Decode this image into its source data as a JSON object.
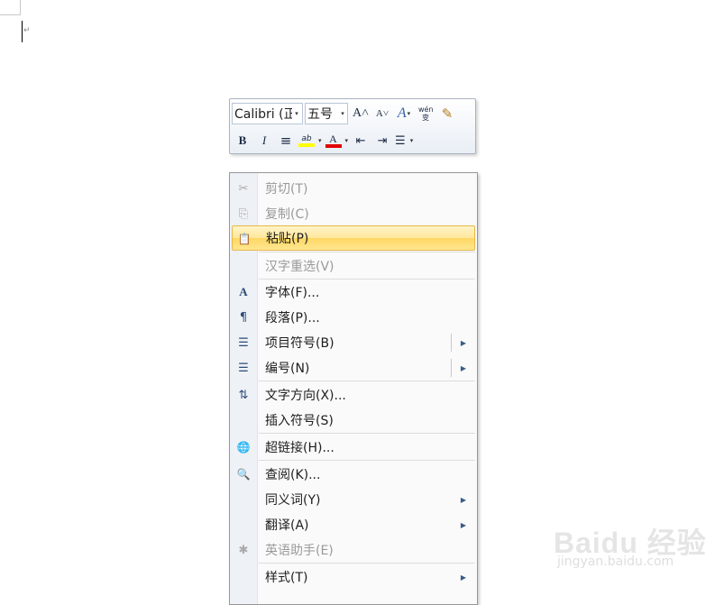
{
  "mini_toolbar": {
    "font_name": "Calibri (正",
    "font_size": "五号",
    "grow_font_icon": "A˄",
    "shrink_font_icon": "A˅",
    "styles_icon": "A",
    "phonetic_icon": "wén 变",
    "format_painter_icon": "✎",
    "bold": "B",
    "italic": "I",
    "center_icon": "≡",
    "highlight_icon": "ab",
    "font_color_icon": "A",
    "decrease_indent_icon": "⇤",
    "increase_indent_icon": "⇥",
    "bullets_icon": "☰",
    "dropdown_arrow": "▾",
    "highlight_color": "#ffff00",
    "font_color": "#e00000"
  },
  "context_menu": {
    "items": [
      {
        "label": "剪切(T)",
        "icon": "✂",
        "disabled": true
      },
      {
        "label": "复制(C)",
        "icon": "⎘",
        "disabled": true
      },
      {
        "label": "粘贴(P)",
        "icon": "📋",
        "disabled": false
      },
      {
        "label": "汉字重选(V)",
        "icon": "",
        "disabled": true
      },
      {
        "label": "字体(F)...",
        "icon": "A",
        "disabled": false
      },
      {
        "label": "段落(P)...",
        "icon": "¶",
        "disabled": false
      },
      {
        "label": "项目符号(B)",
        "icon": "☰",
        "disabled": false
      },
      {
        "label": "编号(N)",
        "icon": "☰",
        "disabled": false
      },
      {
        "label": "文字方向(X)...",
        "icon": "⇅",
        "disabled": false
      },
      {
        "label": "插入符号(S)",
        "icon": "",
        "disabled": false
      },
      {
        "label": "超链接(H)...",
        "icon": "🌐",
        "disabled": false
      },
      {
        "label": "查阅(K)...",
        "icon": "🔍",
        "disabled": false
      },
      {
        "label": "同义词(Y)",
        "icon": "",
        "disabled": false
      },
      {
        "label": "翻译(A)",
        "icon": "",
        "disabled": false
      },
      {
        "label": "英语助手(E)",
        "icon": "✱",
        "disabled": true
      },
      {
        "label": "样式(T)",
        "icon": "",
        "disabled": false
      }
    ],
    "submenu_arrow": "▶",
    "highlight_color": "#ffd763"
  },
  "document": {
    "paragraph_mark": "↵"
  },
  "watermark": {
    "logo": "Baidu 经验",
    "url": "jingyan.baidu.com"
  }
}
